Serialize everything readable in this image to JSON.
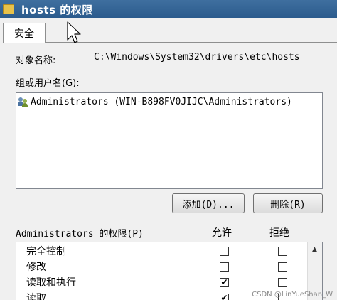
{
  "window": {
    "title": "hosts 的权限"
  },
  "tabs": [
    {
      "label": "安全"
    }
  ],
  "object": {
    "label": "对象名称:",
    "value": "C:\\Windows\\System32\\drivers\\etc\\hosts"
  },
  "groups": {
    "label": "组或用户名(G):",
    "items": [
      {
        "name": "Administrators (WIN-B898FV0JIJC\\Administrators)"
      }
    ]
  },
  "buttons": {
    "add": "添加(D)...",
    "remove": "删除(R)"
  },
  "permissions": {
    "label": "Administrators 的权限(P)",
    "allow_header": "允许",
    "deny_header": "拒绝",
    "rows": [
      {
        "name": "完全控制",
        "allow": "",
        "deny": ""
      },
      {
        "name": "修改",
        "allow": "",
        "deny": ""
      },
      {
        "name": "读取和执行",
        "allow": "✔",
        "deny": ""
      },
      {
        "name": "读取",
        "allow": "✔",
        "deny": ""
      }
    ]
  },
  "watermark": "CSDN @LinYueShan_W"
}
